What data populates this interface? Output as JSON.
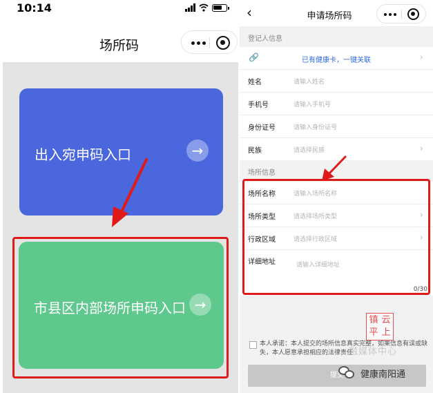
{
  "left": {
    "status_time": "10:14",
    "title": "场所码",
    "cards": [
      {
        "label": "出入宛申码入口",
        "color": "#4a67dd"
      },
      {
        "label": "市县区内部场所申码入口",
        "color": "#5fc88d"
      }
    ]
  },
  "right": {
    "title": "申请场所码",
    "section_registrant": "登记人信息",
    "link_health_card": "已有健康卡，一键关联",
    "fields_person": [
      {
        "label": "姓名",
        "placeholder": "请输入姓名",
        "chevron": false
      },
      {
        "label": "手机号",
        "placeholder": "请输入手机号",
        "chevron": false
      },
      {
        "label": "身份证号",
        "placeholder": "请输入身份证号",
        "chevron": false
      },
      {
        "label": "民族",
        "placeholder": "请选择民族",
        "chevron": true
      }
    ],
    "section_venue": "场所信息",
    "fields_venue": [
      {
        "label": "场所名称",
        "placeholder": "请输入场所名称",
        "chevron": false
      },
      {
        "label": "场所类型",
        "placeholder": "请选择场所类型",
        "chevron": true
      },
      {
        "label": "行政区域",
        "placeholder": "请选择行政区域",
        "chevron": true
      }
    ],
    "detail_address": {
      "label": "详细地址",
      "placeholder": "请输入详细地址",
      "counter": "0/30"
    },
    "agreement": "本人承诺：本人提交的场所信息真实完整，如果信息有误或缺失，本人愿意承担相应的法律责任",
    "submit": "提交"
  },
  "watermark": {
    "stamp_chars": [
      "镇",
      "云",
      "平",
      "上"
    ],
    "overlay_text": "融媒体中心",
    "account_name": "健康南阳通"
  },
  "colors": {
    "highlight": "#e01919",
    "link": "#2d6be4",
    "blue_card": "#4a67dd",
    "green_card": "#5fc88d"
  }
}
